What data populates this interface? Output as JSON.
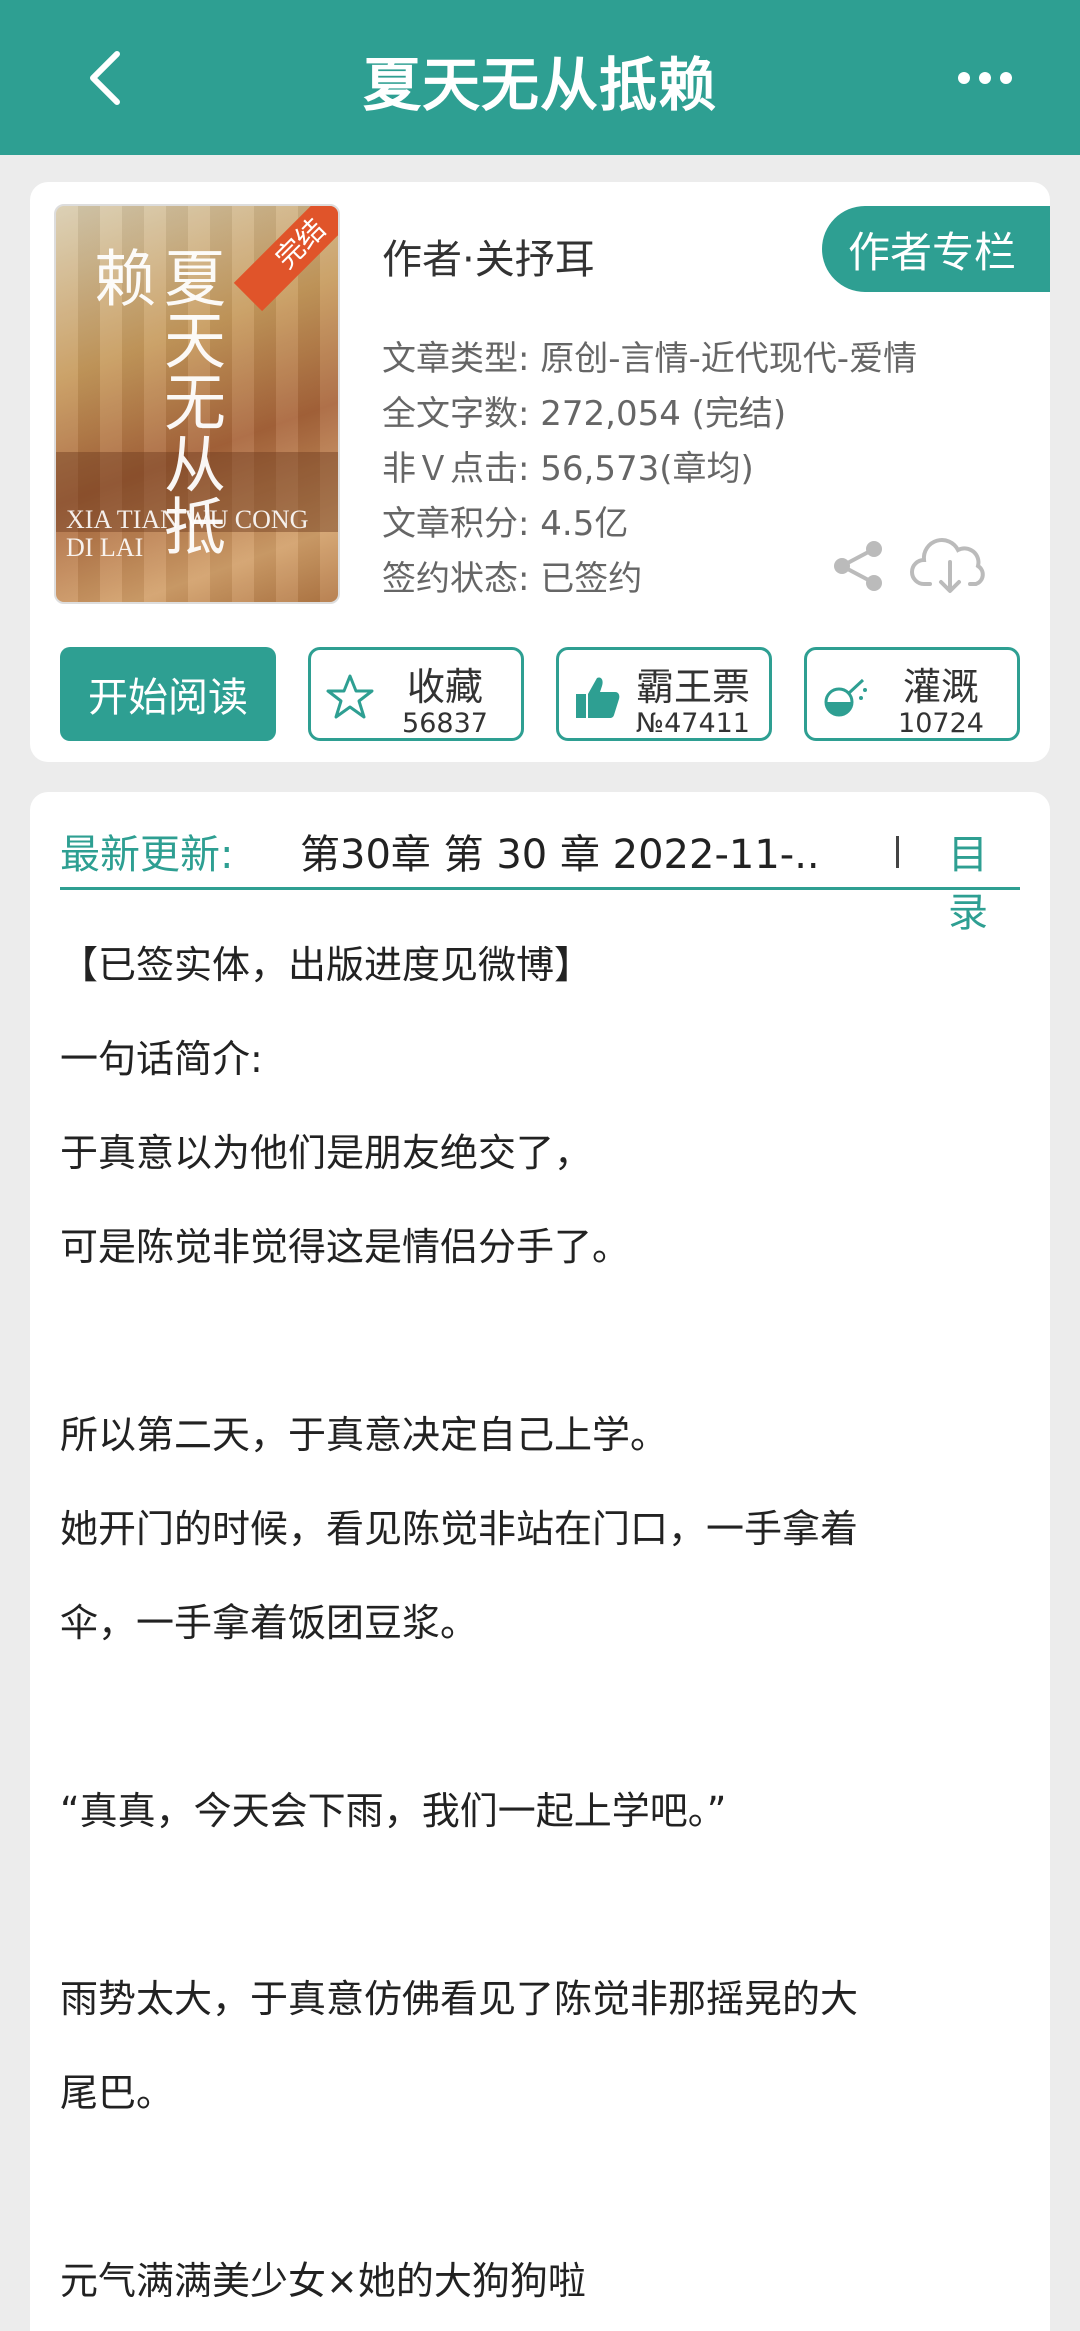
{
  "topbar": {
    "title": "夏天无从抵赖",
    "back_icon": "chevron-left-icon",
    "more_icon": "more-dots-icon"
  },
  "book": {
    "cover": {
      "ribbon": "完结",
      "title_art": "夏天无从抵赖",
      "pinyin": "XIA TIAN WU CONG DI LAI"
    },
    "author": "作者·关抒耳",
    "author_column_button": "作者专栏",
    "meta": [
      "文章类型: 原创-言情-近代现代-爱情",
      "全文字数: 272,054 (完结)",
      "非Ｖ点击: 56,573(章均)",
      "文章积分: 4.5亿",
      "签约状态:  已签约"
    ],
    "start_reading": "开始阅读",
    "actions": [
      {
        "label": "收藏",
        "count": "56837",
        "icon": "star-icon"
      },
      {
        "label": "霸王票",
        "count": "№47411",
        "icon": "thumbs-up-icon"
      },
      {
        "label": "灌溉",
        "count": "10724",
        "icon": "watering-can-icon"
      }
    ]
  },
  "latest_update": {
    "label": "最新更新:",
    "value": "第30章  第 30 章  2022-11-..",
    "toc": "目录"
  },
  "intro": [
    "【已签实体，出版进度见微博】",
    "一句话简介:",
    "于真意以为他们是朋友绝交了，",
    "可是陈觉非觉得这是情侣分手了。",
    "",
    "所以第二天，于真意决定自己上学。",
    "她开门的时候，看见陈觉非站在门口，一手拿着",
    "伞，一手拿着饭团豆浆。",
    "",
    "“真真，今天会下雨，我们一起上学吧。”",
    "",
    "雨势太大，于真意仿佛看见了陈觉非那摇晃的大",
    "尾巴。",
    "",
    "元气满满美少女×她的大狗狗啦"
  ],
  "colors": {
    "accent": "#2e9f92",
    "ribbon": "#e0542a"
  }
}
